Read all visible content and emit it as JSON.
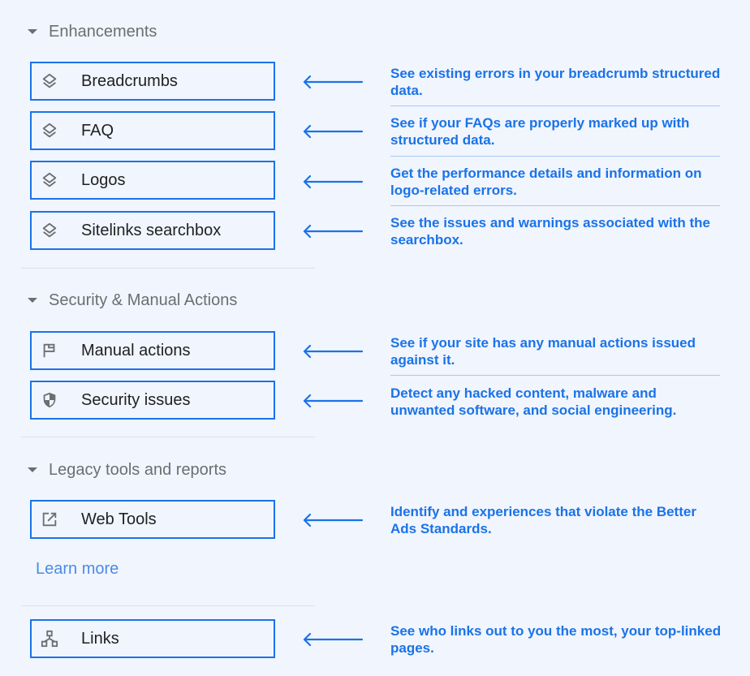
{
  "colors": {
    "accent": "#1a73e8",
    "background": "#f1f5fd",
    "section_text": "#6b6e72",
    "item_text": "#202124",
    "icon": "#6b6e72"
  },
  "sections": [
    {
      "title": "Enhancements",
      "items": [
        {
          "label": "Breadcrumbs",
          "icon": "layers-icon",
          "description": "See existing errors in your breadcrumb structured data."
        },
        {
          "label": "FAQ",
          "icon": "layers-icon",
          "description": "See if your FAQs are properly marked up with structured data."
        },
        {
          "label": "Logos",
          "icon": "layers-icon",
          "description": "Get the performance details and information on logo-related errors."
        },
        {
          "label": "Sitelinks searchbox",
          "icon": "layers-icon",
          "description": "See the issues and warnings associated with the searchbox."
        }
      ]
    },
    {
      "title": "Security & Manual Actions",
      "items": [
        {
          "label": "Manual actions",
          "icon": "flag-icon",
          "description": "See if your site has any manual actions issued against it."
        },
        {
          "label": "Security issues",
          "icon": "shield-icon",
          "description": "Detect any hacked content, malware and unwanted software, and social engineering."
        }
      ]
    },
    {
      "title": "Legacy tools and reports",
      "items": [
        {
          "label": "Web Tools",
          "icon": "external-link-icon",
          "description": "Identify and experiences that violate the Better Ads Standards."
        }
      ],
      "link": "Learn more"
    },
    {
      "title": "",
      "items": [
        {
          "label": "Links",
          "icon": "sitemap-icon",
          "description": "See who links out to you the most, your top-linked pages."
        }
      ]
    }
  ]
}
